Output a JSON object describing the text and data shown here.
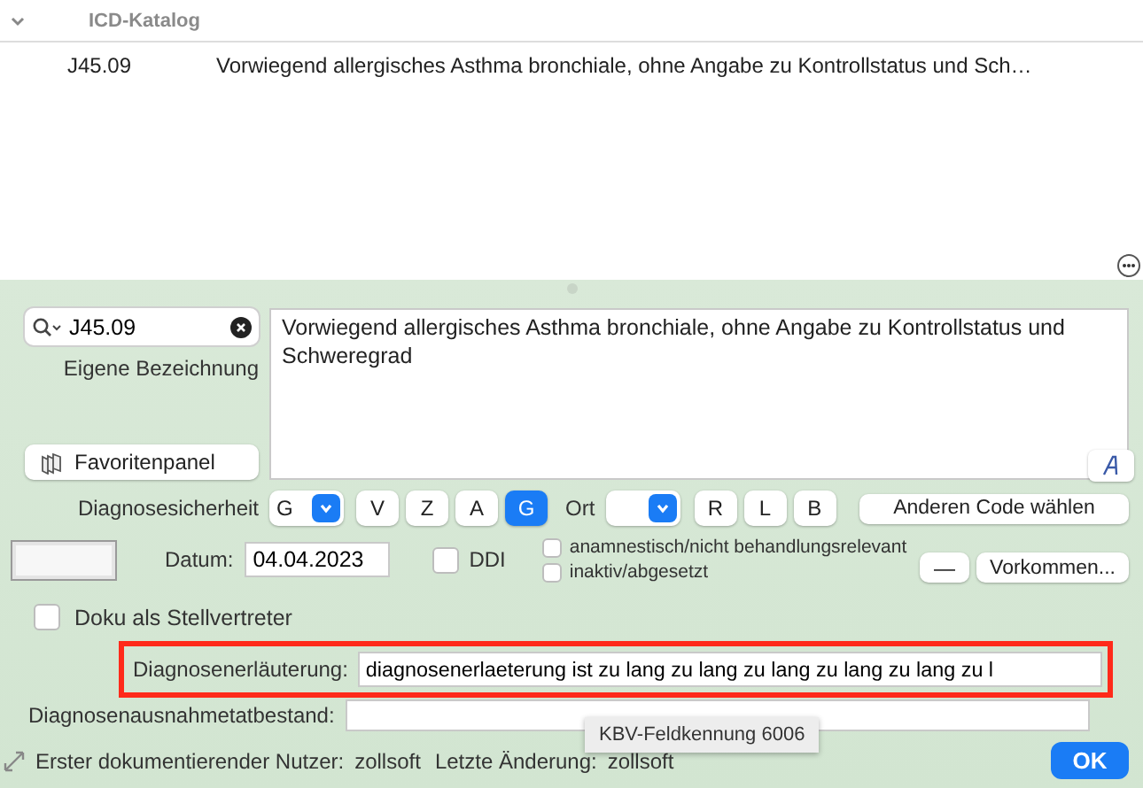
{
  "catalog": {
    "title": "ICD-Katalog",
    "expanded": true,
    "rows": [
      {
        "code": "J45.09",
        "description": "Vorwiegend allergisches Asthma bronchiale, ohne Angabe zu Kontrollstatus und Sch…"
      }
    ]
  },
  "search": {
    "value": "J45.09"
  },
  "custom_name_label": "Eigene Bezeichnung",
  "description": "Vorwiegend allergisches Asthma bronchiale, ohne Angabe zu Kontrollstatus und Schweregrad",
  "favorites_button": "Favoritenpanel",
  "certainty": {
    "label": "Diagnosesicherheit",
    "value": "G",
    "options": [
      {
        "label": "V",
        "selected": false
      },
      {
        "label": "Z",
        "selected": false
      },
      {
        "label": "A",
        "selected": false
      },
      {
        "label": "G",
        "selected": true
      }
    ]
  },
  "location": {
    "label": "Ort",
    "options": [
      {
        "label": "R",
        "selected": false
      },
      {
        "label": "L",
        "selected": false
      },
      {
        "label": "B",
        "selected": false
      }
    ]
  },
  "other_code_button": "Anderen Code wählen",
  "date": {
    "label": "Datum:",
    "value": "04.04.2023"
  },
  "ddi": {
    "label": "DDI",
    "checked": false
  },
  "flags": [
    {
      "label": "anamnestisch/nicht behandlungsrelevant",
      "checked": false
    },
    {
      "label": "inaktiv/abgesetzt",
      "checked": false
    }
  ],
  "dash_button": "—",
  "occurrences_button": "Vorkommen...",
  "proxy": {
    "label": "Doku als Stellvertreter",
    "checked": false
  },
  "explanation": {
    "label": "Diagnosenerläuterung:",
    "value": "diagnosenerlaeterung ist zu lang zu lang zu lang zu lang zu lang zu l",
    "highlighted": true
  },
  "exception": {
    "label": "Diagnosenausnahmetatbestand:"
  },
  "tooltip": "KBV-Feldkennung 6006",
  "footer": {
    "first_user_label": "Erster dokumentierender Nutzer:",
    "first_user": "zollsoft",
    "last_change_label": "Letzte Änderung:",
    "last_change": "zollsoft"
  },
  "ok_button": "OK"
}
